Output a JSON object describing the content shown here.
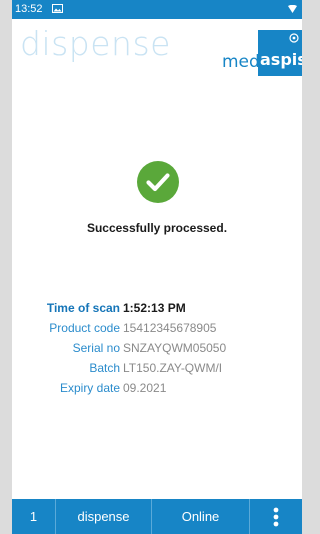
{
  "status_bar": {
    "time": "13:52"
  },
  "header": {
    "title": "dispense"
  },
  "logo": {
    "part1": "med",
    "part2": "aspis"
  },
  "result": {
    "message": "Successfully processed."
  },
  "details": [
    {
      "label": "Time of scan",
      "value": "1:52:13 PM",
      "highlight": true
    },
    {
      "label": "Product code",
      "value": "15412345678905"
    },
    {
      "label": "Serial no",
      "value": "SNZAYQWM05050"
    },
    {
      "label": "Batch",
      "value": "LT150.ZAY-QWM/I"
    },
    {
      "label": "Expiry date",
      "value": "09.2021"
    }
  ],
  "bottom_bar": {
    "count": "1",
    "mode": "dispense",
    "status": "Online"
  },
  "colors": {
    "primary": "#1785c6",
    "success": "#5aa83a",
    "title_faded": "#c9e3f3"
  },
  "icons": {
    "status_left": "gallery-icon",
    "status_right": "wifi-icon",
    "result": "check-circle-icon",
    "menu": "more-vertical-icon"
  }
}
